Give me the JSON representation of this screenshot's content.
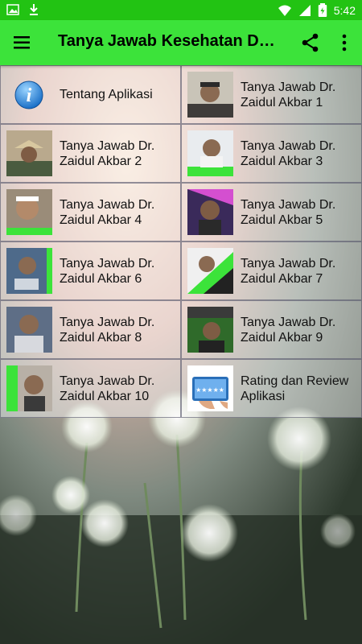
{
  "status": {
    "time": "5:42",
    "icons": [
      "image-icon",
      "download-icon",
      "wifi-icon",
      "signal-icon",
      "battery-icon"
    ]
  },
  "appbar": {
    "title": "Tanya Jawab Kesehatan DR....",
    "icons": [
      "menu-icon",
      "share-icon",
      "more-vert-icon"
    ]
  },
  "colors": {
    "status_bar": "#22c313",
    "app_bar": "#3ce33a"
  },
  "items": [
    {
      "label": "Tentang Aplikasi",
      "icon": "info-icon"
    },
    {
      "label": "Tanya Jawab Dr. Zaidul Akbar 1",
      "icon": "photo-thumb"
    },
    {
      "label": "Tanya Jawab Dr. Zaidul Akbar 2",
      "icon": "photo-thumb"
    },
    {
      "label": "Tanya Jawab Dr. Zaidul Akbar 3",
      "icon": "photo-thumb"
    },
    {
      "label": "Tanya Jawab Dr. Zaidul Akbar 4",
      "icon": "photo-thumb"
    },
    {
      "label": "Tanya Jawab Dr. Zaidul Akbar 5",
      "icon": "photo-thumb"
    },
    {
      "label": "Tanya Jawab Dr. Zaidul Akbar 6",
      "icon": "photo-thumb"
    },
    {
      "label": "Tanya Jawab Dr. Zaidul Akbar 7",
      "icon": "photo-thumb"
    },
    {
      "label": "Tanya Jawab Dr. Zaidul Akbar 8",
      "icon": "photo-thumb"
    },
    {
      "label": "Tanya Jawab Dr. Zaidul Akbar 9",
      "icon": "photo-thumb"
    },
    {
      "label": "Tanya Jawab Dr. Zaidul Akbar 10",
      "icon": "photo-thumb"
    },
    {
      "label": "Rating dan Review Aplikasi",
      "icon": "rating-icon"
    }
  ]
}
